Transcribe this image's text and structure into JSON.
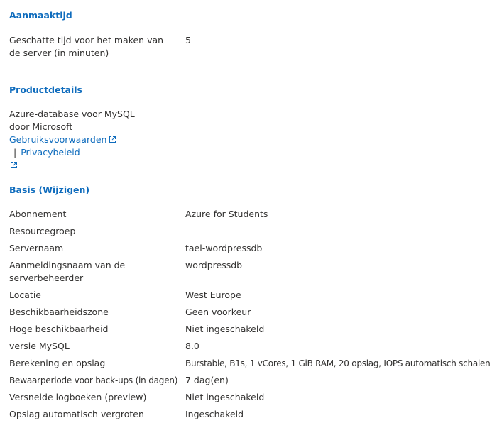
{
  "creation": {
    "title": "Aanmaaktijd",
    "rows": [
      {
        "label": "Geschatte tijd voor het maken van de server (in minuten)",
        "value": "5"
      }
    ]
  },
  "product": {
    "title": "Productdetails",
    "name_line1": "Azure-database voor MySQL",
    "name_line2": "door Microsoft",
    "terms_link": "Gebruiksvoorwaarden",
    "separator": "|",
    "privacy_link": "Privacybeleid"
  },
  "basics": {
    "title": "Basis (Wijzigen)",
    "rows": [
      {
        "label": "Abonnement",
        "value": "Azure for Students"
      },
      {
        "label": "Resourcegroep",
        "value": ""
      },
      {
        "label": "Servernaam",
        "value": "tael-wordpressdb"
      },
      {
        "label": "Aanmeldingsnaam van de serverbeheerder",
        "value": "wordpressdb"
      },
      {
        "label": "Locatie",
        "value": "West Europe"
      },
      {
        "label": "Beschikbaarheidszone",
        "value": "Geen voorkeur"
      },
      {
        "label": "Hoge beschikbaarheid",
        "value": "Niet ingeschakeld"
      },
      {
        "label": "versie MySQL",
        "value": "8.0"
      },
      {
        "label": "Berekening en opslag",
        "value": "Burstable, B1s, 1 vCores, 1 GiB RAM, 20 opslag, IOPS automatisch schalen"
      },
      {
        "label": "Bewaarperiode voor back-ups (in dagen)",
        "value": "7 dag(en)"
      },
      {
        "label": "Versnelde logboeken (preview)",
        "value": "Niet ingeschakeld"
      },
      {
        "label": "Opslag automatisch vergroten",
        "value": "Ingeschakeld"
      }
    ]
  },
  "icons": {
    "external_link": "external-link-icon"
  },
  "colors": {
    "link": "#0f6cbd",
    "text": "#323130"
  }
}
